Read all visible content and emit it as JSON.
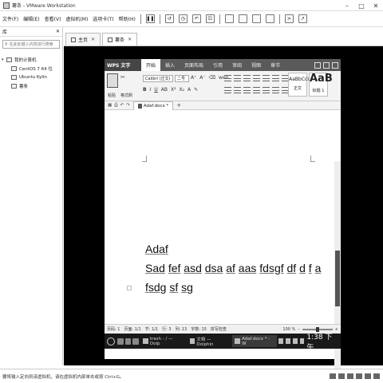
{
  "window": {
    "title": "薯条 - VMware Workstation"
  },
  "menubar": {
    "items": [
      "文件(F)",
      "编辑(E)",
      "查看(V)",
      "虚拟机(M)",
      "选项卡(T)",
      "帮助(H)"
    ]
  },
  "library": {
    "title": "库",
    "search_placeholder": "在此处键入内容进行搜索",
    "root": "我的计算机",
    "vms": [
      "CentOS 7 64 位",
      "Ubuntu Kylin",
      "薯条"
    ]
  },
  "vm_tabs": [
    {
      "label": "主页"
    },
    {
      "label": "薯条"
    }
  ],
  "wps": {
    "logo": "WPS 文字",
    "tabs": [
      "开始",
      "插入",
      "页面布局",
      "引用",
      "审阅",
      "视图",
      "章节"
    ],
    "ribbon": {
      "paste": "粘贴",
      "cut": "剪切",
      "copy": "复制",
      "format_painter": "格式刷",
      "font": "Calibri (正文)",
      "size": "二号",
      "style_normal": "AaBbCcI",
      "style_normal_label": "正文",
      "style_heading": "AaB",
      "style_heading_label": "标题 1"
    },
    "doc_tab": "Adaf.docx *",
    "document_lines": [
      [
        "Adaf"
      ],
      [
        "Sad",
        "fef",
        "asd",
        "dsa",
        "af",
        "aas",
        "fdsgf",
        "df",
        "d",
        "f",
        "a"
      ],
      [
        "fsdg",
        "sf",
        "sg"
      ]
    ],
    "status": {
      "page": "页码: 1",
      "pages": "页面: 1/1",
      "section": "节: 1/1",
      "row": "行: 3",
      "col": "列: 13",
      "words": "字数: 15",
      "spell": "拼写检查",
      "zoom": "100 %"
    }
  },
  "guest_taskbar": {
    "items": [
      "trash - / — Dolp",
      "文档 — Dolphin",
      "Adaf.docx * - W"
    ],
    "clock": "1:38 下午"
  },
  "vm_status": {
    "text": "要将输入定向到该虚拟机，请在虚拟机内部单击或按 Ctrl+G。"
  }
}
